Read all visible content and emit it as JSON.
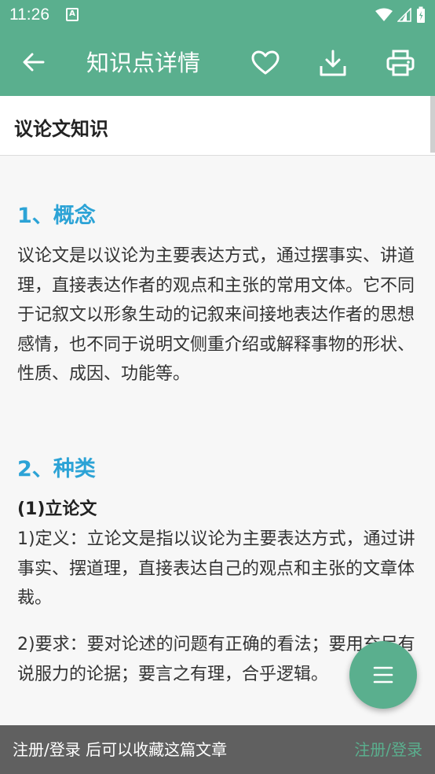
{
  "status_bar": {
    "time": "11:26",
    "notification_icon": "A"
  },
  "app_bar": {
    "title": "知识点详情",
    "icons": [
      "back-arrow-icon",
      "heart-icon",
      "download-icon",
      "print-icon"
    ]
  },
  "document": {
    "title": "议论文知识"
  },
  "content": {
    "section1_heading": "1、概念",
    "section1_text": "议论文是以议论为主要表达方式，通过摆事实、讲道理，直接表达作者的观点和主张的常用文体。它不同于记叙文以形象生动的记叙来间接地表达作者的思想感情，也不同于说明文侧重介绍或解释事物的形状、性质、成因、功能等。",
    "section2_heading": "2、种类",
    "subsection_heading": "(1)立论文",
    "definition_text": "1)定义：立论文是指以议论为主要表达方式，通过讲事实、摆道理，直接表达自己的观点和主张的文章体裁。",
    "requirement_text": "2)要求：要对论述的问题有正确的看法；要用充足有说服力的论据；要言之有理，合乎逻辑。"
  },
  "fab": {
    "icon": "menu-icon"
  },
  "snackbar": {
    "message": "注册/登录 后可以收藏这篇文章",
    "action": "注册/登录"
  },
  "colors": {
    "primary": "#5aaf8e",
    "heading_blue": "#2ca3d6",
    "snackbar_bg": "#606060"
  }
}
